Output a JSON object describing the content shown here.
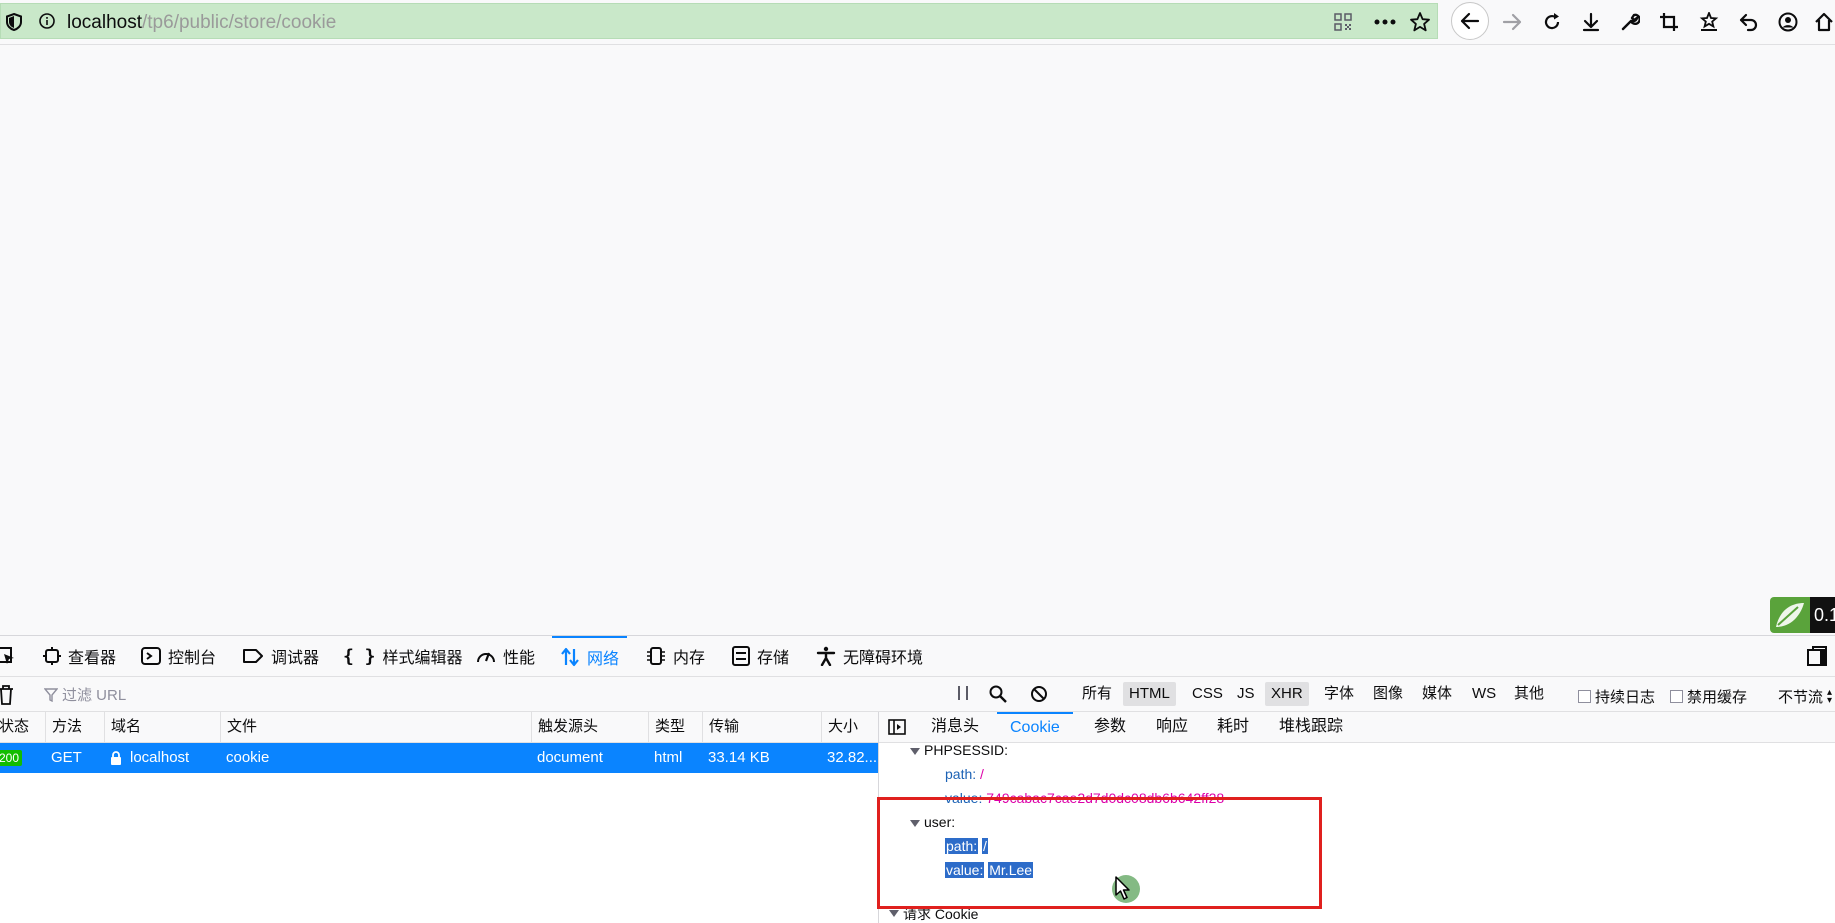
{
  "browser": {
    "url_host": "localhost",
    "url_path": "/tp6/public/store/cookie"
  },
  "page": {
    "extension_badge_text": "0.1"
  },
  "devtools": {
    "tabs": [
      {
        "label": "查看器",
        "icon": "inspector-icon"
      },
      {
        "label": "控制台",
        "icon": "console-icon"
      },
      {
        "label": "调试器",
        "icon": "debugger-icon"
      },
      {
        "label": "样式编辑器",
        "icon": "style-editor-icon"
      },
      {
        "label": "性能",
        "icon": "performance-icon"
      },
      {
        "label": "网络",
        "icon": "network-icon",
        "active": true
      },
      {
        "label": "内存",
        "icon": "memory-icon"
      },
      {
        "label": "存储",
        "icon": "storage-icon"
      },
      {
        "label": "无障碍环境",
        "icon": "accessibility-icon"
      }
    ],
    "filter_placeholder": "过滤 URL",
    "type_filters": [
      {
        "label": "所有",
        "on": false
      },
      {
        "label": "HTML",
        "on": true
      },
      {
        "label": "CSS",
        "on": false
      },
      {
        "label": "JS",
        "on": false
      },
      {
        "label": "XHR",
        "on": true
      },
      {
        "label": "字体",
        "on": false
      },
      {
        "label": "图像",
        "on": false
      },
      {
        "label": "媒体",
        "on": false
      },
      {
        "label": "WS",
        "on": false
      },
      {
        "label": "其他",
        "on": false
      }
    ],
    "persist_logs_label": "持续日志",
    "disable_cache_label": "禁用缓存",
    "throttle_label": "不节流",
    "columns": [
      "状态",
      "方法",
      "域名",
      "文件",
      "触发源头",
      "类型",
      "传输",
      "大小"
    ],
    "request": {
      "status": "200",
      "method": "GET",
      "domain": "localhost",
      "file": "cookie",
      "cause": "document",
      "type": "html",
      "transferred": "33.14 KB",
      "size": "32.82..."
    },
    "detail_tabs": [
      "消息头",
      "Cookie",
      "参数",
      "响应",
      "耗时",
      "堆栈跟踪"
    ],
    "active_detail_tab": "Cookie",
    "cookies": {
      "phpsessid_name": "PHPSESSID:",
      "phpsessid_path_key": "path:",
      "phpsessid_path_val": "/",
      "phpsessid_value_key": "value:",
      "phpsessid_value_val": "749cabac7cae2d7d0dc08db6b642ff28",
      "user_name": "user:",
      "user_path_key": "path:",
      "user_path_val": "/",
      "user_value_key": "value:",
      "user_value_val": "Mr.Lee",
      "request_cookie_label": "请求 Cookie"
    }
  }
}
